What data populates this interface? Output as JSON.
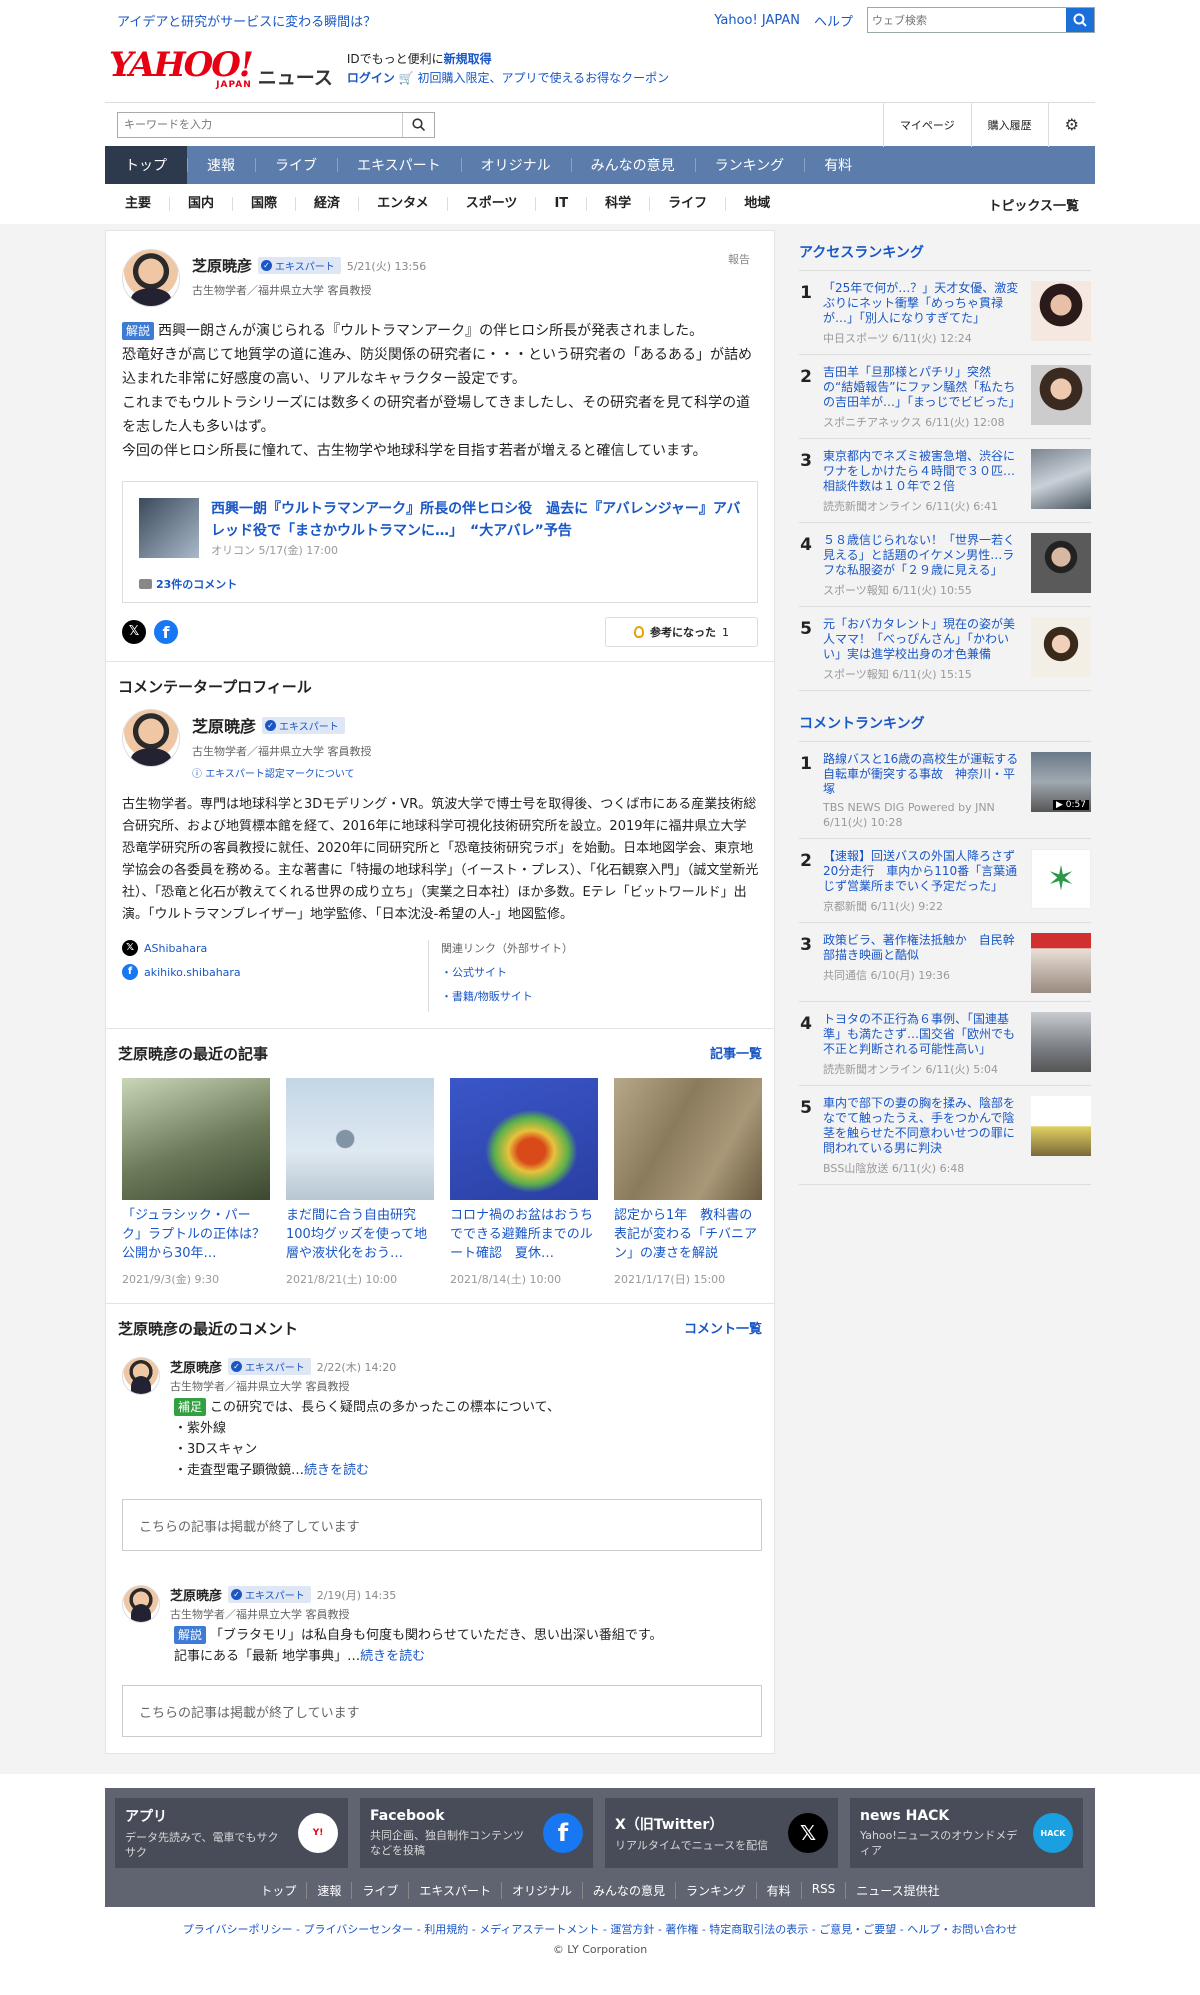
{
  "topbar": {
    "promo": "アイデアと研究がサービスに変わる瞬間は？",
    "yahoo": "Yahoo! JAPAN",
    "help": "ヘルプ",
    "search_placeholder": "ウェブ検索"
  },
  "logo": {
    "yahoo": "YAHOO!",
    "japan": "JAPAN",
    "news": "ニュース"
  },
  "idbox": {
    "line1_pre": "IDでもっと便利に",
    "line1_link": "新規取得",
    "login": "ログイン",
    "coupon": "初回購入限定、アプリで使えるお得なクーポン"
  },
  "search": {
    "placeholder": "キーワードを入力",
    "mypage": "マイページ",
    "history": "購入履歴"
  },
  "mainnav": [
    "トップ",
    "速報",
    "ライブ",
    "エキスパート",
    "オリジナル",
    "みんなの意見",
    "ランキング",
    "有料"
  ],
  "subnav": {
    "items": [
      "主要",
      "国内",
      "国際",
      "経済",
      "エンタメ",
      "スポーツ",
      "IT",
      "科学",
      "ライフ",
      "地域"
    ],
    "topics": "トピックス一覧"
  },
  "comment": {
    "name": "芝原暁彦",
    "badge": "エキスパート",
    "time": "5/21(火) 13:56",
    "affil": "古生物学者／福井県立大学 客員教授",
    "report": "報告",
    "tag": "解説",
    "lines": [
      "西興一朗さんが演じられる『ウルトラマンアーク』の伴ヒロシ所長が発表されました。",
      "恐竜好きが高じて地質学の道に進み、防災関係の研究者に・・・という研究者の「あるある」が詰め込まれた非常に好感度の高い、リアルなキャラクター設定です。",
      "これまでもウルトラシリーズには数多くの研究者が登場してきましたし、その研究者を見て科学の道を志した人も多いはず。",
      "今回の伴ヒロシ所長に憧れて、古生物学や地球科学を目指す若者が増えると確信しています。"
    ],
    "card": {
      "title": "西興一朗『ウルトラマンアーク』所長の伴ヒロシ役　過去に『アバレンジャー』アバレッド役で「まさかウルトラマンに…」　“大アバレ”予告",
      "source": "オリコン 5/17(金) 17:00",
      "comments": "23件のコメント"
    },
    "helpful": "参考になった",
    "helpful_count": "1"
  },
  "profile": {
    "heading": "コメンテータープロフィール",
    "name": "芝原暁彦",
    "badge": "エキスパート",
    "affil": "古生物学者／福井県立大学 客員教授",
    "mark": "エキスパート認定マークについて",
    "bio": "古生物学者。専門は地球科学と3Dモデリング・VR。筑波大学で博士号を取得後、つくば市にある産業技術総合研究所、および地質標本館を経て、2016年に地球科学可視化技術研究所を設立。2019年に福井県立大学 恐竜学研究所の客員教授に就任、2020年に同研究所と「恐竜技術研究ラボ」を始動。日本地図学会、東京地学協会の各委員を務める。主な著書に「特撮の地球科学」（イースト・プレス）、「化石観察入門」（誠文堂新光社）、「恐竜と化石が教えてくれる世界の成り立ち」（実業之日本社）ほか多数。Eテレ「ビットワールド」出演。「ウルトラマンブレイザー」地学監修、「日本沈没-希望の人-」地図監修。",
    "x": "AShibahara",
    "fb": "akihiko.shibahara",
    "related_head": "関連リンク（外部サイト）",
    "related": [
      "・公式サイト",
      "・書籍/物販サイト"
    ]
  },
  "recent_articles": {
    "heading": "芝原暁彦の最近の記事",
    "more": "記事一覧",
    "items": [
      {
        "title": "「ジュラシック・パーク」ラプトルの正体は？　公開から30年…",
        "date": "2021/9/3(金) 9:30"
      },
      {
        "title": "まだ間に合う自由研究　100均グッズを使って地層や液状化をおう…",
        "date": "2021/8/21(土) 10:00"
      },
      {
        "title": "コロナ禍のお盆はおうちでできる避難所までのルート確認　夏休…",
        "date": "2021/8/14(土) 10:00"
      },
      {
        "title": "認定から1年　教科書の表記が変わる「チバニアン」の凄さを解説",
        "date": "2021/1/17(日) 15:00"
      }
    ]
  },
  "recent_comments": {
    "heading": "芝原暁彦の最近のコメント",
    "more": "コメント一覧",
    "items": [
      {
        "name": "芝原暁彦",
        "badge": "エキスパート",
        "time": "2/22(木) 14:20",
        "affil": "古生物学者／福井県立大学 客員教授",
        "tag": "補足",
        "lines": [
          "この研究では、長らく疑問点の多かったこの標本について、",
          "・紫外線",
          "・3Dスキャン"
        ],
        "last": "・走査型電子顕微鏡…",
        "more": "続きを読む",
        "ended": "こちらの記事は掲載が終了しています"
      },
      {
        "name": "芝原暁彦",
        "badge": "エキスパート",
        "time": "2/19(月) 14:35",
        "affil": "古生物学者／福井県立大学 客員教授",
        "tag": "解説",
        "lines": [
          "「ブラタモリ」は私自身も何度も関わらせていただき、思い出深い番組です。"
        ],
        "last": "記事にある「最新 地学事典」…",
        "more": "続きを読む",
        "ended": "こちらの記事は掲載が終了しています"
      }
    ]
  },
  "access_ranking": {
    "heading": "アクセスランキング",
    "items": [
      {
        "n": "1",
        "title": "「25年で何が…？」天才女優、激変ぶりにネット衝撃「めっちゃ貫禄が…」「別人になりすぎてた」",
        "src": "中日スポーツ 6/11(火) 12:24"
      },
      {
        "n": "2",
        "title": "吉田羊「旦那様とパチリ」突然の“結婚報告”にファン騒然「私たちの吉田羊が…」「まっじでビビった」",
        "src": "スポニチアネックス 6/11(火) 12:08"
      },
      {
        "n": "3",
        "title": "東京都内でネズミ被害急増、渋谷にワナをしかけたら４時間で３０匹…相談件数は１０年で２倍",
        "src": "読売新聞オンライン 6/11(火) 6:41"
      },
      {
        "n": "4",
        "title": "５８歳信じられない！「世界一若く見える」と話題のイケメン男性…ラフな私服姿が「２９歳に見える」",
        "src": "スポーツ報知 6/11(火) 10:55"
      },
      {
        "n": "5",
        "title": "元「おバカタレント」現在の姿が美人ママ！「べっぴんさん」「かわいい」実は進学校出身の才色兼備",
        "src": "スポーツ報知 6/11(火) 15:15"
      }
    ]
  },
  "comment_ranking": {
    "heading": "コメントランキング",
    "items": [
      {
        "n": "1",
        "title": "路線バスと16歳の高校生が運転する自転車が衝突する事故　神奈川・平塚",
        "src": "TBS NEWS DIG Powered by JNN 6/11(火) 10:28",
        "dur": "▶ 0:57"
      },
      {
        "n": "2",
        "title": "【速報】回送バスの外国人降ろさず20分走行　車内から110番「言葉通じず営業所までいく予定だった」",
        "src": "京都新聞 6/11(火) 9:22"
      },
      {
        "n": "3",
        "title": "政策ビラ、著作権法抵触か　自民幹部描き映画と酷似",
        "src": "共同通信 6/10(月) 19:36"
      },
      {
        "n": "4",
        "title": "トヨタの不正行為６事例、「国連基準」も満たさず…国交省「欧州でも不正と判断される可能性高い」",
        "src": "読売新聞オンライン 6/11(火) 5:04"
      },
      {
        "n": "5",
        "title": "車内で部下の妻の胸を揉み、陰部をなでて触ったうえ、手をつかんで陰茎を触らせた不同意わいせつの罪に問われている男に判決",
        "src": "BSS山陰放送 6/11(火) 6:48"
      }
    ]
  },
  "footer": {
    "cards": [
      {
        "title": "アプリ",
        "desc": "データ先読みで、電車でもサクサク"
      },
      {
        "title": "Facebook",
        "desc": "共同企画、独自制作コンテンツなどを投稿"
      },
      {
        "title": "X（旧Twitter）",
        "desc": "リアルタイムでニュースを配信"
      },
      {
        "title": "news HACK",
        "desc": "Yahoo!ニュースのオウンドメディア"
      }
    ],
    "links": [
      "トップ",
      "速報",
      "ライブ",
      "エキスパート",
      "オリジナル",
      "みんなの意見",
      "ランキング",
      "有料",
      "RSS",
      "ニュース提供社"
    ],
    "legal": "プライバシーポリシー - プライバシーセンター - 利用規約 - メディアステートメント - 運営方針 - 著作権 - 特定商取引法の表示 - ご意見・ご要望 - ヘルプ・お問い合わせ",
    "copyright": "© LY Corporation"
  },
  "colors": {
    "accent": "#1a57c6",
    "nav": "#5c7dab",
    "nav_active": "#2d3a4d",
    "brand": "#e60012"
  }
}
